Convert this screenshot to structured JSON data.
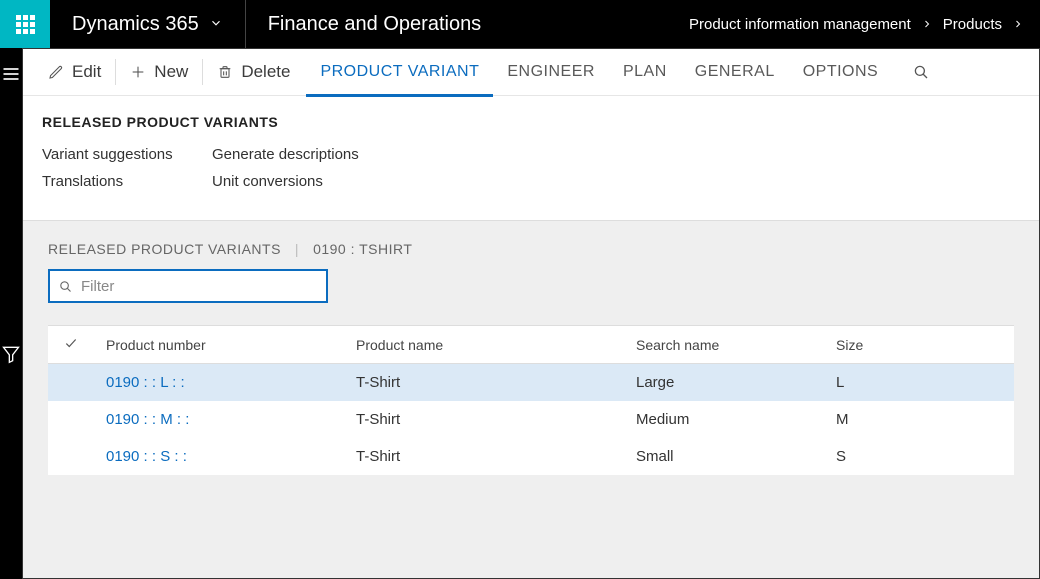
{
  "topbar": {
    "app_name": "Dynamics 365",
    "module": "Finance and Operations"
  },
  "breadcrumb": {
    "level1": "Product information management",
    "level2": "Products"
  },
  "actionpane": {
    "edit": "Edit",
    "new": "New",
    "delete": "Delete",
    "tabs": {
      "product_variant": "PRODUCT VARIANT",
      "engineer": "ENGINEER",
      "plan": "PLAN",
      "general": "GENERAL",
      "options": "OPTIONS"
    }
  },
  "section": {
    "title": "RELEASED PRODUCT VARIANTS",
    "links": {
      "variant_suggestions": "Variant suggestions",
      "generate_descriptions": "Generate descriptions",
      "translations": "Translations",
      "unit_conversions": "Unit conversions"
    }
  },
  "context": {
    "title": "RELEASED PRODUCT VARIANTS",
    "record": "0190 : TSHIRT"
  },
  "filter": {
    "placeholder": "Filter",
    "value": ""
  },
  "table": {
    "columns": {
      "product_number": "Product number",
      "product_name": "Product name",
      "search_name": "Search name",
      "size": "Size"
    },
    "rows": [
      {
        "selected": true,
        "product_number": "0190 :  : L :  :",
        "product_name": "T-Shirt",
        "search_name": "Large",
        "size": "L"
      },
      {
        "selected": false,
        "product_number": "0190 :  : M :  :",
        "product_name": "T-Shirt",
        "search_name": "Medium",
        "size": "M"
      },
      {
        "selected": false,
        "product_number": "0190 :  : S :  :",
        "product_name": "T-Shirt",
        "search_name": "Small",
        "size": "S"
      }
    ]
  }
}
